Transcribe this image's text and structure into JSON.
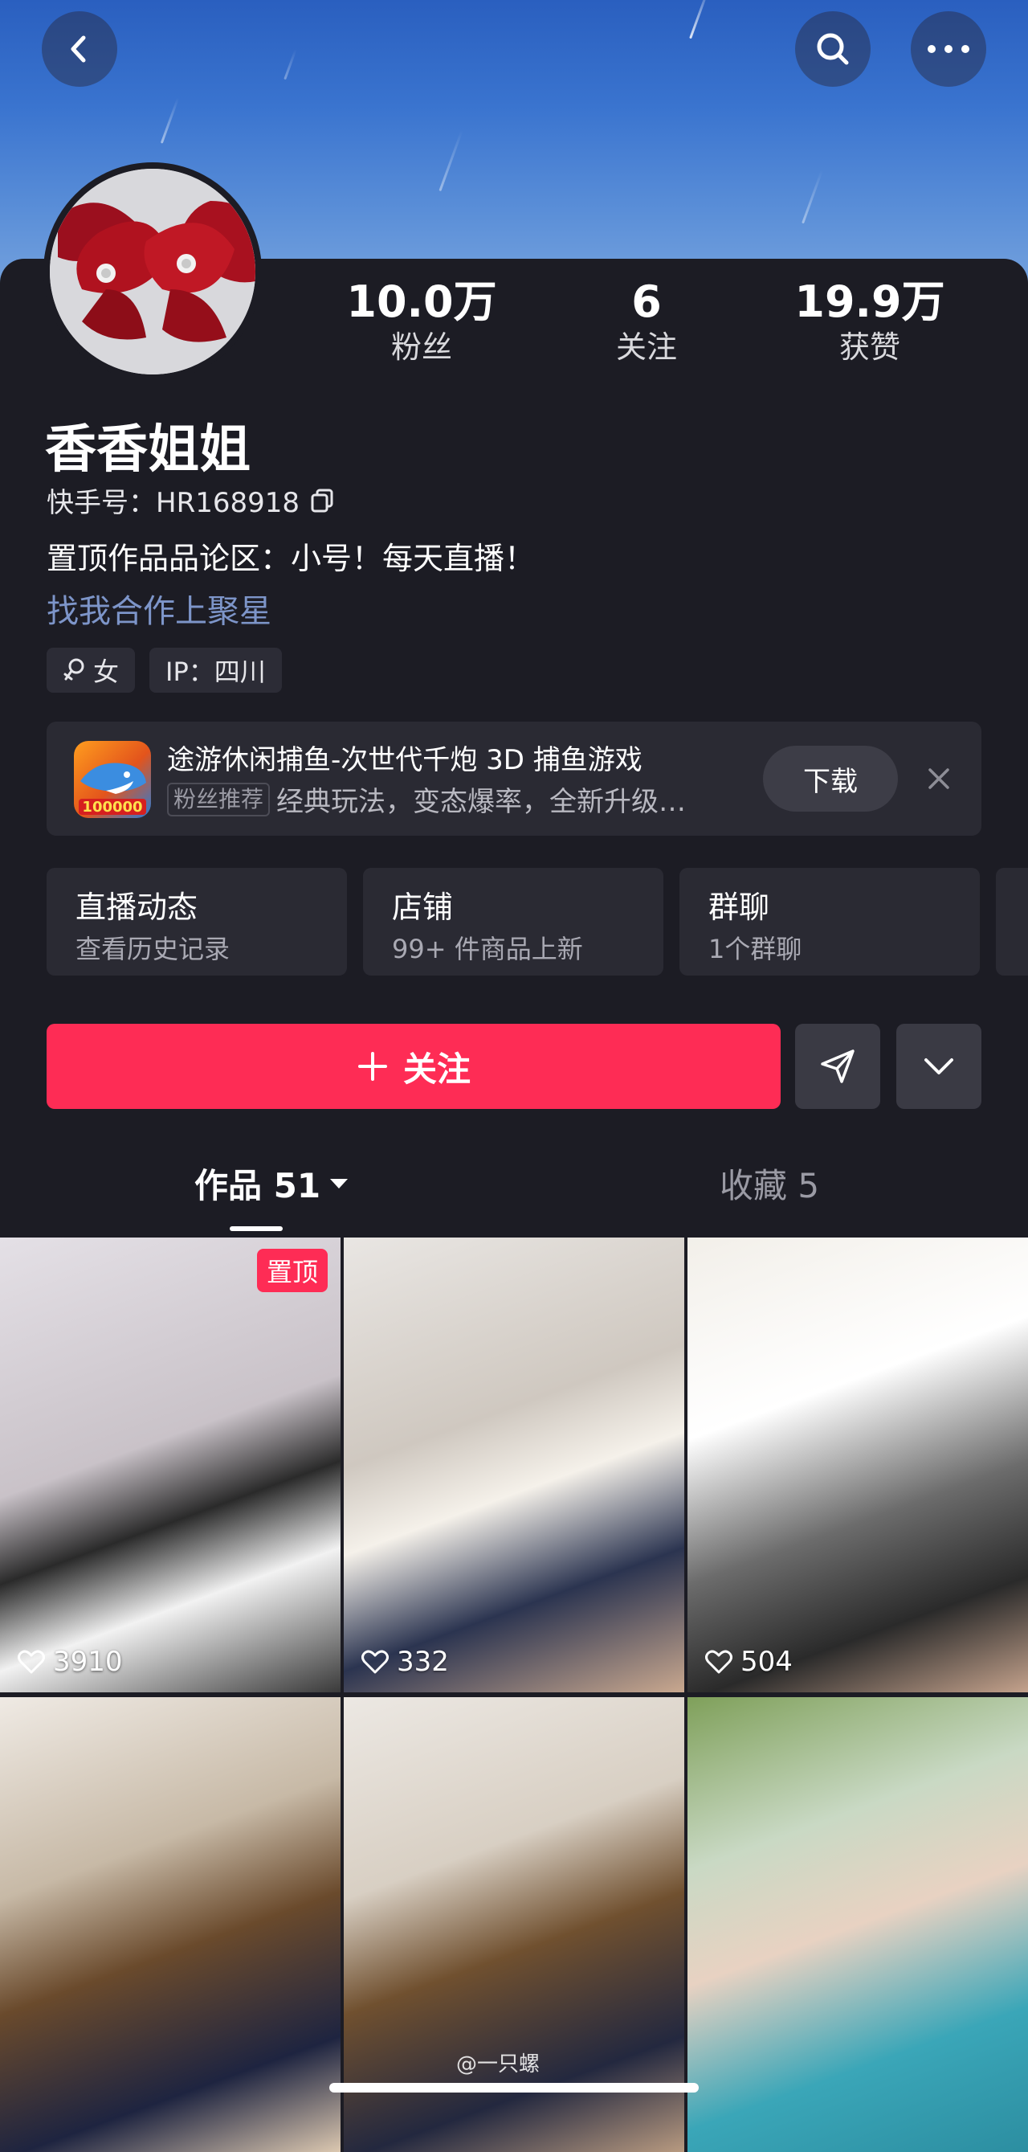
{
  "header": {
    "back_icon": "chevron-left-icon",
    "search_icon": "search-icon",
    "more_icon": "more-icon"
  },
  "profile": {
    "avatar_icon": "red-bow-avatar",
    "stats": [
      {
        "value": "10.0万",
        "label": "粉丝"
      },
      {
        "value": "6",
        "label": "关注"
      },
      {
        "value": "19.9万",
        "label": "获赞"
      }
    ],
    "name": "香香姐姐",
    "id_text": "快手号：HR168918",
    "bio": "置顶作品品论区：小号！每天直播！",
    "link": "找我合作上聚星",
    "tags": [
      {
        "icon": "female-icon",
        "label": "女"
      },
      {
        "label": "IP：四川"
      }
    ]
  },
  "ad": {
    "title": "途游休闲捕鱼-次世代千炮 3D 捕鱼游戏",
    "badge": "粉丝推荐",
    "desc": "经典玩法，变态爆率，全新升级…",
    "icon_text": "100000",
    "button": "下载"
  },
  "entries": [
    {
      "title": "直播动态",
      "subtitle": "查看历史记录"
    },
    {
      "title": "店铺",
      "subtitle": "99+ 件商品上新"
    },
    {
      "title": "群聊",
      "subtitle": "1个群聊"
    }
  ],
  "actions": {
    "follow_label": "关注"
  },
  "tabs": [
    {
      "label": "作品 51",
      "active": true
    },
    {
      "label": "收藏 5",
      "active": false
    }
  ],
  "videos": [
    {
      "likes": "3910",
      "pinned": true,
      "pin_label": "置顶"
    },
    {
      "likes": "332",
      "pinned": false
    },
    {
      "likes": "504",
      "pinned": false
    },
    {
      "likes": "",
      "pinned": false
    },
    {
      "likes": "",
      "pinned": false
    },
    {
      "likes": "",
      "pinned": false
    }
  ],
  "watermark": "@一只螺",
  "colors": {
    "accent": "#fe2c55",
    "background": "#1c1c24",
    "link": "#7d95c9"
  }
}
